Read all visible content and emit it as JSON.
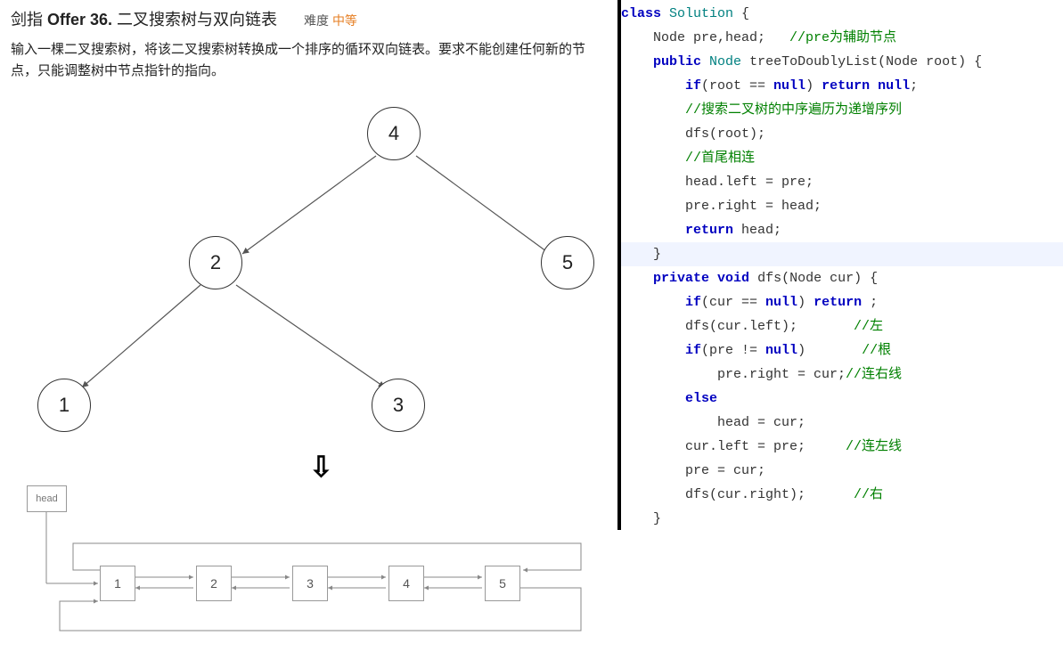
{
  "problem": {
    "title_prefix": "剑指 ",
    "title_bold": "Offer 36.",
    "title_rest": " 二叉搜索树与双向链表",
    "difficulty_label": "难度",
    "difficulty_value": "中等",
    "description": "输入一棵二叉搜索树，将该二叉搜索树转换成一个排序的循环双向链表。要求不能创建任何新的节点，只能调整树中节点指针的指向。"
  },
  "tree": {
    "nodes": [
      "4",
      "2",
      "5",
      "1",
      "3"
    ]
  },
  "list": {
    "head_label": "head",
    "items": [
      "1",
      "2",
      "3",
      "4",
      "5"
    ]
  },
  "code": {
    "l1_kw1": "class",
    "l1_cls": "Solution",
    "l1_rest": " {",
    "l2_pre": "    Node pre,head;   ",
    "l2_cmt": "//pre为辅助节点",
    "l3_kw1": "public",
    "l3_cls": "Node",
    "l3_mth": "treeToDoublyList",
    "l3_par": "(Node root) {",
    "l4_pre": "        ",
    "l4_kw": "if",
    "l4_mid": "(root == ",
    "l4_kw2": "null",
    "l4_mid2": ") ",
    "l4_kw3": "return",
    "l4_mid3": " ",
    "l4_kw4": "null",
    "l4_end": ";",
    "l5_pre": "        ",
    "l5_cmt": "//搜索二叉树的中序遍历为递增序列",
    "l6": "        dfs(root);",
    "l7_pre": "        ",
    "l7_cmt": "//首尾相连",
    "l8": "        head.left = pre;",
    "l9": "        pre.right = head;",
    "l10_pre": "        ",
    "l10_kw": "return",
    "l10_end": " head;",
    "l11": "    }",
    "l12_pre": "    ",
    "l12_kw1": "private",
    "l12_kw2": "void",
    "l12_mth": "dfs",
    "l12_par": "(Node cur) {",
    "l13_pre": "        ",
    "l13_kw": "if",
    "l13_mid": "(cur == ",
    "l13_kw2": "null",
    "l13_mid2": ") ",
    "l13_kw3": "return",
    "l13_end": " ;",
    "l14_pre": "        dfs(cur.left);       ",
    "l14_cmt": "//左",
    "l15_pre": "        ",
    "l15_kw": "if",
    "l15_mid": "(pre != ",
    "l15_kw2": "null",
    "l15_mid2": ")       ",
    "l15_cmt": "//根",
    "l16_pre": "            pre.right = cur;",
    "l16_cmt": "//连右线",
    "l17_pre": "        ",
    "l17_kw": "else",
    "l18": "            head = cur;",
    "l19_pre": "        cur.left = pre;     ",
    "l19_cmt": "//连左线",
    "l20": "        pre = cur;",
    "l21_pre": "        dfs(cur.right);      ",
    "l21_cmt": "//右",
    "l22": "    }"
  }
}
